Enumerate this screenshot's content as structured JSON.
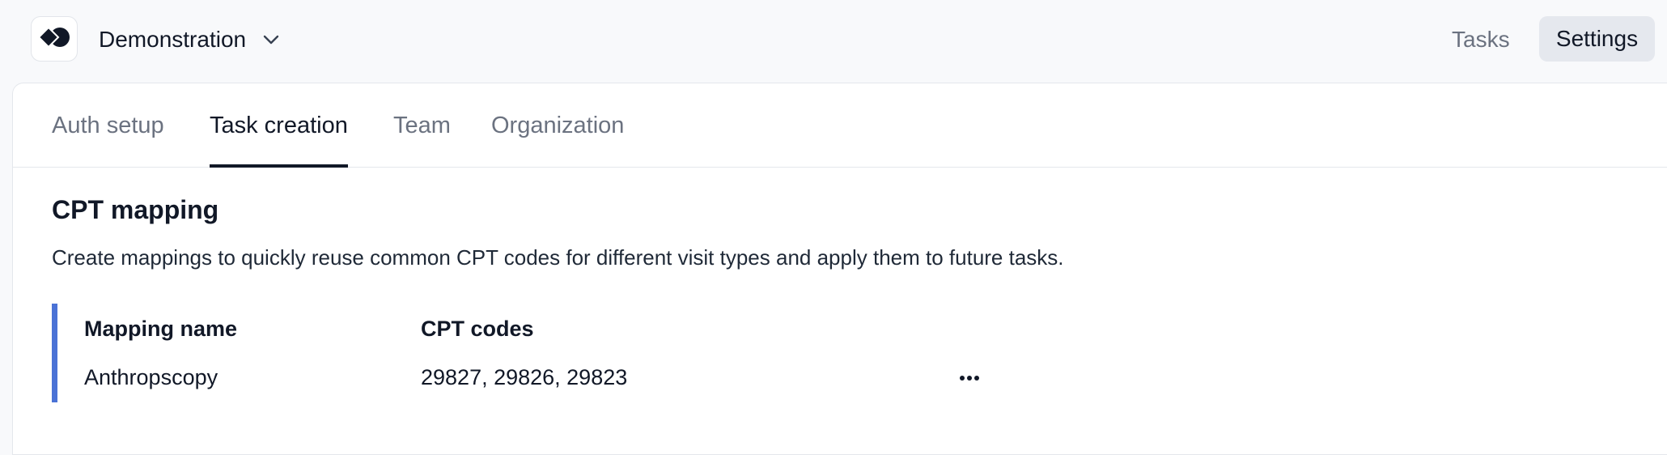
{
  "header": {
    "org_name": "Demonstration",
    "nav": {
      "tasks_label": "Tasks",
      "settings_label": "Settings"
    }
  },
  "settings": {
    "tabs": [
      {
        "label": "Auth setup",
        "active": false
      },
      {
        "label": "Task creation",
        "active": true
      },
      {
        "label": "Team",
        "active": false
      },
      {
        "label": "Organization",
        "active": false
      }
    ],
    "cpt_mapping": {
      "title": "CPT mapping",
      "description": "Create mappings to quickly reuse common CPT codes for different visit types and apply them to future tasks.",
      "columns": {
        "name": "Mapping name",
        "codes": "CPT codes"
      },
      "rows": [
        {
          "name": "Anthropscopy",
          "codes": "29827, 29826, 29823"
        }
      ],
      "accent_color": "#4a72d6"
    }
  },
  "icons": {
    "logo": "logo-icon",
    "org_dropdown": "chevron-down-icon",
    "row_actions": "more-horizontal-icon"
  }
}
